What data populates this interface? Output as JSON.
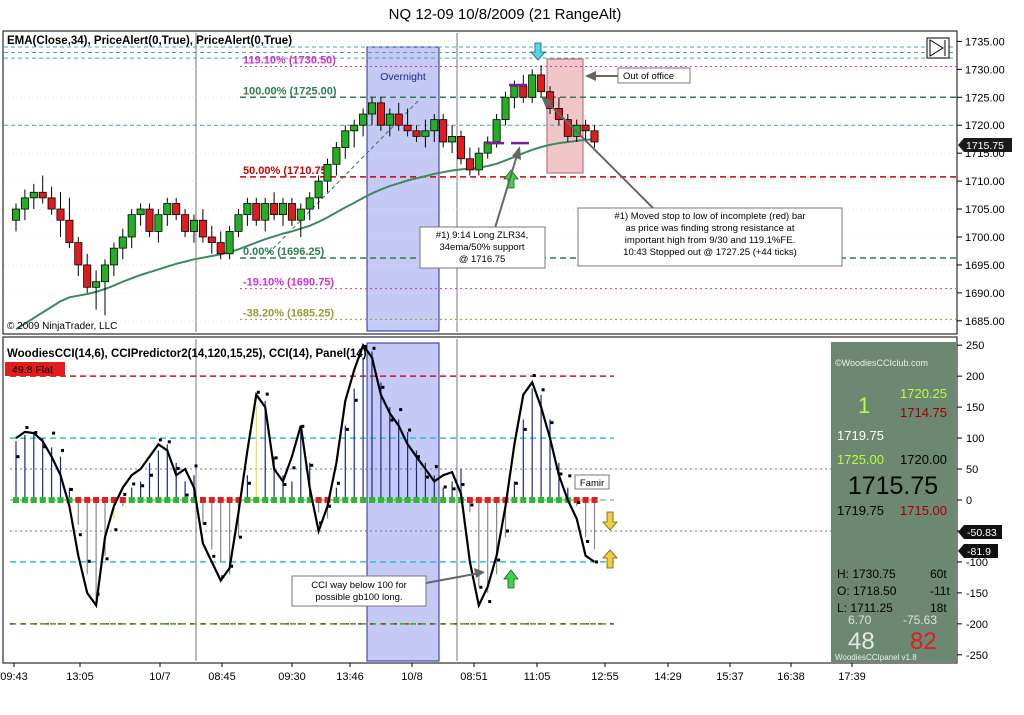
{
  "window": {
    "title": "NQ 12-09  10/8/2009 (21 RangeAlt)"
  },
  "copyright": "© 2009 NinjaTrader, LLC",
  "price_panel": {
    "indicator_label": "EMA(Close,34), PriceAlert(0,True), PriceAlert(0,True)",
    "session_label": "Overnight",
    "fib_levels": [
      {
        "label": "119.10% (1730.50)",
        "price": 1730.5,
        "color": "#cc33cc",
        "style": "dotted"
      },
      {
        "label": "100.00% (1725.00)",
        "price": 1725.0,
        "color": "#2e7d4f",
        "style": "dashed"
      },
      {
        "label": "50.00% (1710.75)",
        "price": 1710.75,
        "color": "#cc0000",
        "style": "dashed"
      },
      {
        "label": "0.00% (1696.25)",
        "price": 1696.25,
        "color": "#2e7d4f",
        "style": "dashed"
      },
      {
        "label": "-19.10% (1690.75)",
        "price": 1690.75,
        "color": "#cc33cc",
        "style": "dotted"
      },
      {
        "label": "-38.20% (1685.25)",
        "price": 1685.25,
        "color": "#999933",
        "style": "dotted"
      }
    ],
    "current_price_badge": "1715.75",
    "annotations": {
      "out_of_office": "Out of office",
      "long_note": [
        "#1) 9:14 Long ZLR34,",
        "34ema/50% support",
        "@ 1716.75"
      ],
      "stop_note": [
        "#1) Moved stop to low of incomplete (red) bar",
        "as price was finding strong resistance at",
        "important high from 9/30 and 119.1%FE.",
        "10:43 Stopped out @ 1727.25 (+44 ticks)"
      ]
    }
  },
  "cci_panel": {
    "indicator_label": "WoodiesCCI(14,6), CCIPredictor2(14,120,15,25), CCI(14), Panel(14)",
    "status_badge": "49.8 Flat",
    "famir_label": "Famir",
    "cci_note": [
      "CCI way below 100 for",
      "possible gb100 long."
    ],
    "value_badges": [
      "-50.83",
      "-81.9"
    ]
  },
  "woodies_panel": {
    "site": "©WoodiesCCIclub.com",
    "big_count": "1",
    "row1_green": "1720.25",
    "row1_red": "1714.75",
    "row2_white": "1719.75",
    "row3_green": "1725.00",
    "row3_white": "1720.00",
    "main_price": "1715.75",
    "row4_white": "1719.75",
    "row4_red": "1715.00",
    "h_line": "H: 1730.75",
    "h_ticks": "60t",
    "o_line": "O: 1718.50",
    "o_ticks": "-11t",
    "l_line": "L: 1711.25",
    "l_ticks": "18t",
    "small_left": "6.70",
    "small_right": "-75.63",
    "bottom_left": "48",
    "bottom_right": "82",
    "version": "WoodiesCCIpanel v1.8"
  },
  "chart_data": [
    {
      "type": "candlestick",
      "title": "NQ 12-09  10/8/2009 (21 RangeAlt)",
      "y_ticks": [
        1735,
        1730,
        1725,
        1720,
        1715,
        1710,
        1705,
        1700,
        1695,
        1690,
        1685
      ],
      "ylim": [
        1683,
        1736.5
      ],
      "x_tick_labels": [
        "09:43",
        "13:05",
        "10/7",
        "08:45",
        "09:30",
        "13:46",
        "10/8",
        "08:51",
        "11:05",
        "12:55",
        "14:29",
        "15:37",
        "16:38",
        "17:39"
      ],
      "ohlc": [
        [
          1703,
          1706,
          1701,
          1705
        ],
        [
          1705,
          1708.5,
          1703,
          1707
        ],
        [
          1707,
          1709.5,
          1705,
          1708
        ],
        [
          1708,
          1711,
          1706,
          1707
        ],
        [
          1707,
          1709,
          1704,
          1705
        ],
        [
          1705,
          1708,
          1700,
          1703
        ],
        [
          1703,
          1707,
          1698,
          1699
        ],
        [
          1699,
          1700,
          1693,
          1695
        ],
        [
          1695,
          1697,
          1690,
          1691
        ],
        [
          1691,
          1694,
          1687,
          1692
        ],
        [
          1692,
          1696,
          1686,
          1695
        ],
        [
          1695,
          1699,
          1693,
          1698
        ],
        [
          1698,
          1701.5,
          1696,
          1700
        ],
        [
          1700,
          1705,
          1698,
          1704
        ],
        [
          1704,
          1706,
          1702,
          1705
        ],
        [
          1705,
          1706,
          1700,
          1701
        ],
        [
          1701,
          1705,
          1699,
          1704
        ],
        [
          1704,
          1707,
          1702,
          1706
        ],
        [
          1706,
          1707,
          1703,
          1704
        ],
        [
          1704,
          1705,
          1700,
          1701
        ],
        [
          1701,
          1704,
          1699,
          1703
        ],
        [
          1703,
          1705,
          1699,
          1700
        ],
        [
          1700,
          1702,
          1697,
          1699
        ],
        [
          1699,
          1701,
          1696,
          1697
        ],
        [
          1697,
          1702,
          1696,
          1701
        ],
        [
          1701,
          1705,
          1700,
          1704
        ],
        [
          1704,
          1707,
          1702,
          1706
        ],
        [
          1706,
          1707,
          1702,
          1703
        ],
        [
          1703,
          1707,
          1701,
          1706
        ],
        [
          1706,
          1708,
          1703,
          1704
        ],
        [
          1704,
          1707,
          1702,
          1706
        ],
        [
          1706,
          1707,
          1702,
          1703
        ],
        [
          1703,
          1706,
          1700,
          1705
        ],
        [
          1705,
          1708,
          1703,
          1707
        ],
        [
          1707,
          1711,
          1705,
          1710
        ],
        [
          1710,
          1714,
          1708,
          1713
        ],
        [
          1713,
          1717,
          1711,
          1716
        ],
        [
          1716,
          1720,
          1714,
          1719
        ],
        [
          1719,
          1721,
          1716,
          1720
        ],
        [
          1720,
          1723,
          1718,
          1722
        ],
        [
          1722,
          1725,
          1720,
          1724
        ],
        [
          1724,
          1725,
          1719,
          1720
        ],
        [
          1720,
          1723,
          1718,
          1722
        ],
        [
          1722,
          1724,
          1719,
          1720
        ],
        [
          1720,
          1723,
          1718,
          1719
        ],
        [
          1719,
          1720,
          1717,
          1718
        ],
        [
          1718,
          1721,
          1716,
          1719
        ],
        [
          1719,
          1722,
          1717,
          1721
        ],
        [
          1721,
          1722,
          1716,
          1717
        ],
        [
          1717,
          1720,
          1715,
          1718
        ],
        [
          1718,
          1719,
          1713,
          1714
        ],
        [
          1714,
          1716,
          1711,
          1712
        ],
        [
          1712,
          1716,
          1711,
          1715
        ],
        [
          1715,
          1718,
          1714,
          1717
        ],
        [
          1717,
          1722,
          1716,
          1721
        ],
        [
          1721,
          1726,
          1720,
          1725
        ],
        [
          1725,
          1728,
          1723,
          1727
        ],
        [
          1727,
          1729,
          1724,
          1725
        ],
        [
          1725,
          1730,
          1724,
          1729
        ],
        [
          1729,
          1730.75,
          1725,
          1726
        ],
        [
          1726,
          1727,
          1722,
          1723
        ],
        [
          1723,
          1725,
          1720,
          1721
        ],
        [
          1721,
          1722,
          1717,
          1718
        ],
        [
          1718,
          1721,
          1717,
          1720
        ],
        [
          1720,
          1721,
          1717,
          1719
        ],
        [
          1719,
          1720,
          1716,
          1717
        ]
      ],
      "ema34": [
        1683.5,
        1684.5,
        1685.5,
        1686.5,
        1687.5,
        1688.5,
        1689.2,
        1689.5,
        1689.8,
        1690.2,
        1690.7,
        1691.3,
        1692,
        1692.6,
        1693.2,
        1693.7,
        1694.2,
        1694.7,
        1695.2,
        1695.6,
        1696,
        1696.3,
        1696.6,
        1696.9,
        1697.3,
        1697.8,
        1698.4,
        1699,
        1699.6,
        1700.1,
        1700.6,
        1701,
        1701.5,
        1702,
        1702.7,
        1703.5,
        1704.4,
        1705.3,
        1706.1,
        1707,
        1707.8,
        1708.5,
        1709.1,
        1709.6,
        1710.1,
        1710.5,
        1710.9,
        1711.3,
        1711.6,
        1711.9,
        1712.1,
        1712.2,
        1712.4,
        1712.7,
        1713.1,
        1713.7,
        1714.3,
        1715,
        1715.6,
        1716.1,
        1716.5,
        1716.8,
        1717,
        1717.2,
        1717.4,
        1717.5
      ],
      "series": [
        {
          "name": "EMA(Close,34)",
          "values_key": "ema34"
        }
      ]
    },
    {
      "type": "line",
      "title": "WoodiesCCI(14,6), CCIPredictor2(14,120,15,25), CCI(14), Panel(14)",
      "y_ticks": [
        250,
        200,
        150,
        100,
        50,
        0,
        -50,
        -100,
        -150,
        -200,
        -250
      ],
      "ylim": [
        -260,
        260
      ],
      "reference_lines": [
        200,
        100,
        50,
        0,
        -50,
        -100,
        -200
      ],
      "cci": [
        95,
        105,
        110,
        100,
        85,
        70,
        20,
        -40,
        -120,
        -160,
        -90,
        -30,
        -10,
        20,
        30,
        60,
        80,
        90,
        60,
        30,
        40,
        -40,
        -80,
        -100,
        -120,
        -60,
        40,
        150,
        160,
        70,
        40,
        30,
        110,
        60,
        -20,
        -30,
        20,
        120,
        180,
        230,
        240,
        190,
        150,
        130,
        110,
        80,
        60,
        40,
        20,
        30,
        50,
        -20,
        -140,
        -150,
        -120,
        -60,
        30,
        130,
        180,
        170,
        130,
        60,
        20,
        -10,
        -60,
        -80
      ],
      "turbo_cci": [
        100,
        110,
        108,
        95,
        70,
        40,
        -10,
        -90,
        -150,
        -170,
        -60,
        -10,
        20,
        40,
        50,
        70,
        90,
        80,
        40,
        50,
        20,
        -70,
        -100,
        -130,
        -110,
        -20,
        80,
        170,
        150,
        50,
        30,
        70,
        120,
        20,
        -50,
        -10,
        60,
        160,
        210,
        250,
        230,
        170,
        140,
        120,
        90,
        70,
        50,
        30,
        40,
        45,
        10,
        -100,
        -170,
        -140,
        -90,
        -10,
        90,
        170,
        190,
        150,
        100,
        40,
        0,
        -30,
        -90,
        -100
      ]
    }
  ]
}
